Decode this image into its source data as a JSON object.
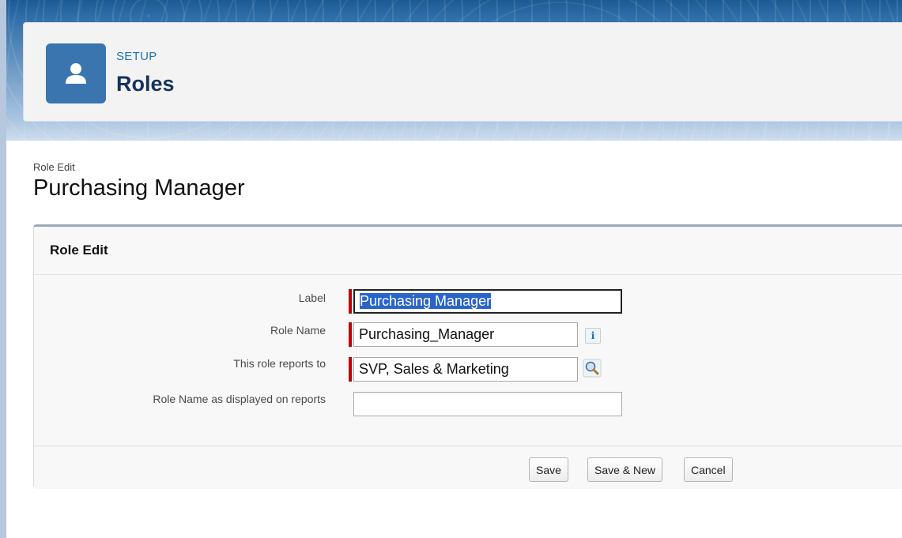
{
  "header": {
    "setup_label": "SETUP",
    "page_title": "Roles",
    "icon": "user-icon",
    "icon_color": "#3a75b0"
  },
  "breadcrumb": {
    "subtitle": "Role Edit",
    "title": "Purchasing Manager"
  },
  "panel": {
    "title": "Role Edit",
    "fields": [
      {
        "label": "Label",
        "value": "Purchasing Manager",
        "required": true,
        "selected": true
      },
      {
        "label": "Role Name",
        "value": "Purchasing_Manager",
        "required": true,
        "icon": "info-icon"
      },
      {
        "label": "This role reports to",
        "value": "SVP, Sales & Marketing",
        "required": true,
        "icon": "lookup-icon"
      },
      {
        "label": "Role Name as displayed on reports",
        "value": "",
        "required": false
      }
    ],
    "buttons": {
      "save": "Save",
      "save_new": "Save & New",
      "cancel": "Cancel"
    },
    "info_glyph": "i"
  },
  "colors": {
    "required": "#c00000",
    "selection": "#2a64c9",
    "heading": "#16325c",
    "accent": "#1b75bb"
  }
}
